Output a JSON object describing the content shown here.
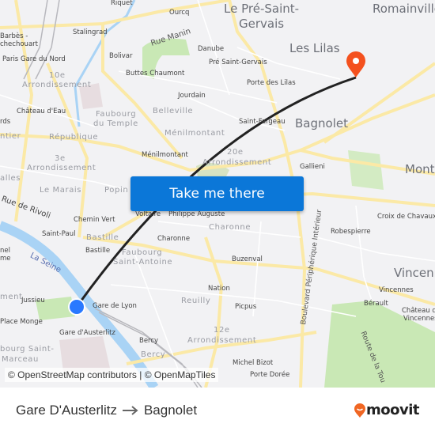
{
  "map": {
    "labels": {
      "riquet": "Riquet",
      "ourcq": "Ourcq",
      "stalingrad": "Stalingrad",
      "rue_manin": "Rue Manin",
      "barbes": "Barbès -",
      "rochechouart": "chechouart",
      "gare_du_nord": "Paris Gare du Nord",
      "bolivar": "Bolivar",
      "danube": "Danube",
      "pre_saint_gervais_stop": "Pré Saint-Gervais",
      "buttes_chaumont": "Buttes Chaumont",
      "arr10_num": "10e",
      "arr10": "Arrondissement",
      "jourdain": "Jourdain",
      "chateau_deau": "Château d'Eau",
      "faubourg": "Faubourg",
      "du_temple": "du Temple",
      "belleville": "Belleville",
      "menilmontant_district": "Ménilmontant",
      "republique": "République",
      "menilmontant_stop": "Ménilmontant",
      "arr3_num": "3e",
      "arr3": "Arrondissement",
      "le_marais": "Le Marais",
      "popincourt": "Popin",
      "rue_de_rivoli": "Rue de Rivoli",
      "chemin_vert": "Chemin Vert",
      "saint_paul": "Saint-Paul",
      "bastille_district": "Bastille",
      "bastille_stop": "Bastille",
      "la_seine": "La Seine",
      "faubourg_sa1": "Faubourg",
      "faubourg_sa2": "Saint-Antoine",
      "voltaire": "Voltaire",
      "philippe_auguste": "Philippe Auguste",
      "charonne_stop": "Charonne",
      "charonne_district": "Charonne",
      "jussieu": "Jussieu",
      "gare_de_lyon": "Gare de Lyon",
      "place_monge": "Place Monge",
      "gare_austerlitz": "Gare d'Austerlitz",
      "reuilly": "Reuilly",
      "nation": "Nation",
      "bercy_stop": "Bercy",
      "bercy_district": "Bercy",
      "arr12_num": "12e",
      "arr12": "Arrondissement",
      "faubourg_sm1": "bourg Saint-",
      "faubourg_sm2": "Marceau",
      "le_pre_saint": "Le Pré-Saint-",
      "gervais": "Gervais",
      "romainville": "Romainville",
      "les_lilas": "Les Lilas",
      "porte_des_lilas": "Porte des Lilas",
      "saint_fargeau": "Saint-Fargeau",
      "bagnolet": "Bagnolet",
      "arr20_num": "20e",
      "arr20": "Arrondissement",
      "gallieni": "Gallieni",
      "montreuil": "Montr",
      "croix_de_chavaux": "Croix de Chavaux",
      "robespierre": "Robespierre",
      "buzenval": "Buzenval",
      "boulevard_peripherique": "Boulevard Périphérique Intérieur",
      "vincennes_city": "Vincenn",
      "vincennes_stop": "Vincennes",
      "berault": "Bérault",
      "chateau_vincennes1": "Château de",
      "chateau_vincennes2": "Vincennes",
      "picpus": "Picpus",
      "route_de_la_tourelle": "Route de la Tou",
      "michel_bizot": "Michel Bizot",
      "porte_doree": "Porte Dorée",
      "arr_left": "Arrondissement",
      "halles": "alles",
      "sentier": "ntier",
      "ards": "rds",
      "nel": "nel",
      "me": "me",
      "ment": "ment"
    },
    "origin_marker": {
      "icon": "origin-dot-icon",
      "color": "#2979ff"
    },
    "destination_marker": {
      "icon": "destination-pin-icon",
      "color": "#f4511e"
    },
    "route_line_color": "#222222",
    "cta_label": "Take me there",
    "attribution": "© OpenStreetMap contributors | © OpenMapTiles"
  },
  "footer": {
    "origin": "Gare D'Austerlitz",
    "arrow_icon": "arrow-right-icon",
    "destination": "Bagnolet",
    "brand": "moovit",
    "brand_color": "#f06623"
  }
}
